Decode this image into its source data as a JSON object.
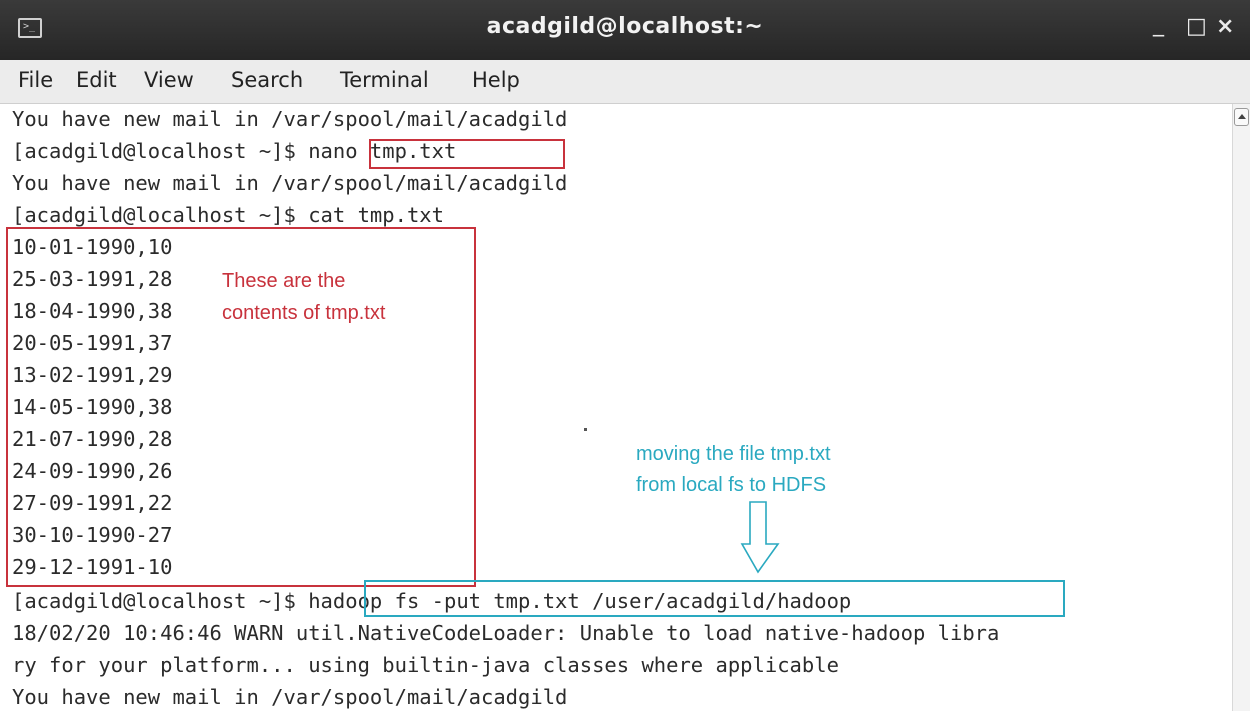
{
  "window": {
    "title": "acadgild@localhost:~",
    "icon": "terminal-icon",
    "controls": {
      "minimize": "_",
      "maximize": "□",
      "close": "×"
    }
  },
  "menu": {
    "items": [
      "File",
      "Edit",
      "View",
      "Search",
      "Terminal",
      "Help"
    ]
  },
  "terminal": {
    "lines": [
      "You have new mail in /var/spool/mail/acadgild",
      "[acadgild@localhost ~]$ nano tmp.txt",
      "You have new mail in /var/spool/mail/acadgild",
      "[acadgild@localhost ~]$ cat tmp.txt",
      "10-01-1990,10",
      "25-03-1991,28",
      "18-04-1990,38",
      "20-05-1991,37",
      "13-02-1991,29",
      "14-05-1990,38",
      "21-07-1990,28",
      "24-09-1990,26",
      "27-09-1991,22",
      "30-10-1990-27",
      "29-12-1991-10",
      "[acadgild@localhost ~]$ hadoop fs -put tmp.txt /user/acadgild/hadoop",
      "18/02/20 10:46:46 WARN util.NativeCodeLoader: Unable to load native-hadoop libra",
      "ry for your platform... using builtin-java classes where applicable",
      "You have new mail in /var/spool/mail/acadgild"
    ]
  },
  "annotations": {
    "contents_note_line1": "These are the",
    "contents_note_line2": "contents of tmp.txt",
    "move_note_line1": "moving the file tmp.txt",
    "move_note_line2": "from local fs to HDFS",
    "red_color": "#c8323c",
    "teal_color": "#2aa9c0"
  }
}
